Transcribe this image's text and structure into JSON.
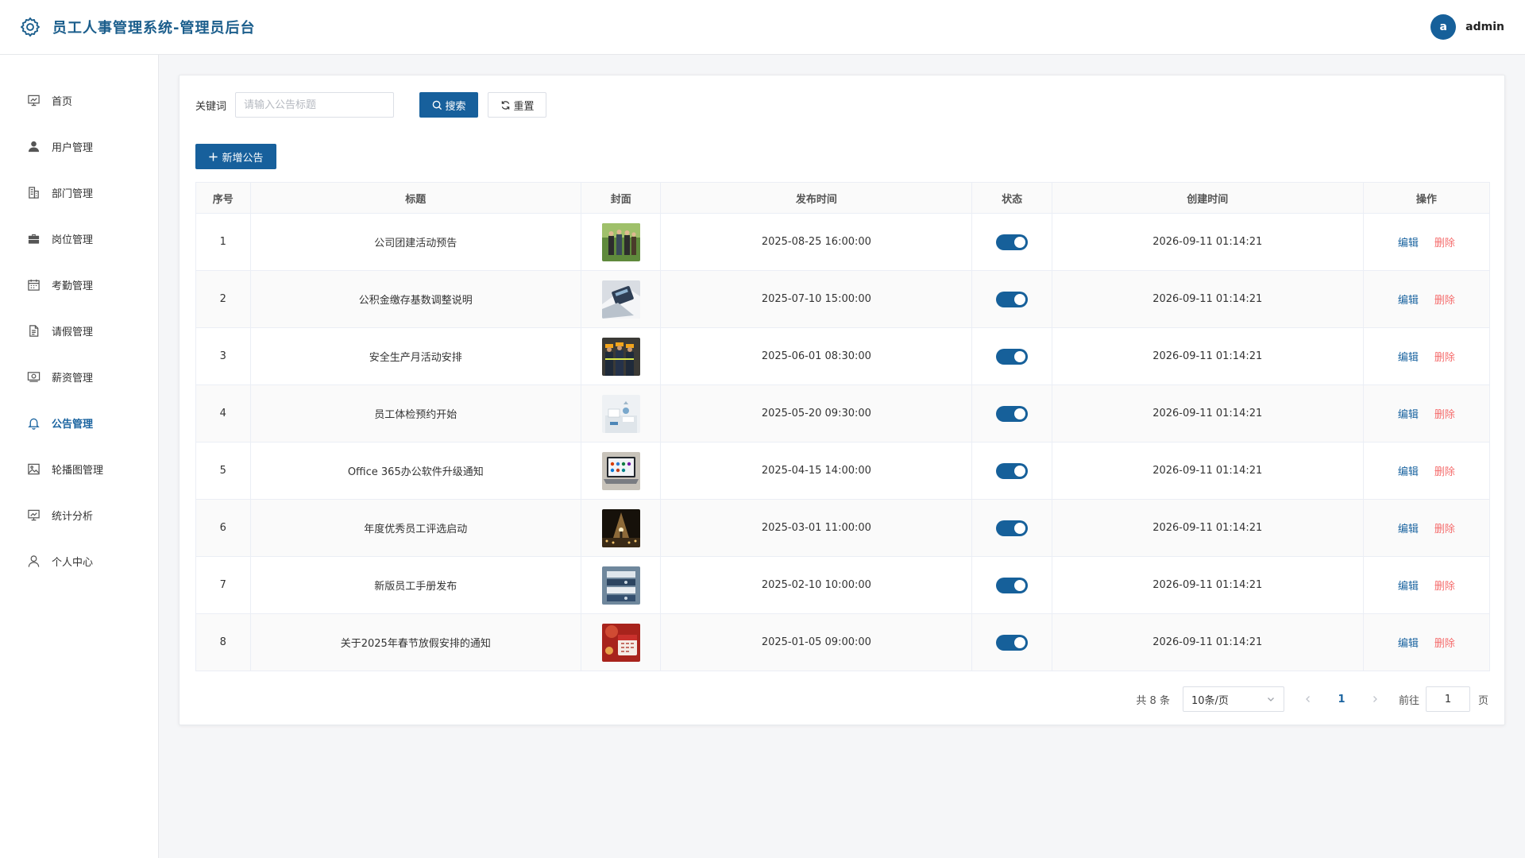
{
  "header": {
    "title": "员工人事管理系统-管理员后台",
    "avatar_letter": "a",
    "username": "admin"
  },
  "sidebar": {
    "items": [
      {
        "label": "首页",
        "icon": "dashboard-icon",
        "active": false
      },
      {
        "label": "用户管理",
        "icon": "user-icon",
        "active": false
      },
      {
        "label": "部门管理",
        "icon": "building-icon",
        "active": false
      },
      {
        "label": "岗位管理",
        "icon": "briefcase-icon",
        "active": false
      },
      {
        "label": "考勤管理",
        "icon": "calendar-icon",
        "active": false
      },
      {
        "label": "请假管理",
        "icon": "document-icon",
        "active": false
      },
      {
        "label": "薪资管理",
        "icon": "money-icon",
        "active": false
      },
      {
        "label": "公告管理",
        "icon": "bell-icon",
        "active": true
      },
      {
        "label": "轮播图管理",
        "icon": "picture-icon",
        "active": false
      },
      {
        "label": "统计分析",
        "icon": "presentation-icon",
        "active": false
      },
      {
        "label": "个人中心",
        "icon": "person-icon",
        "active": false
      }
    ]
  },
  "search": {
    "label": "关键词",
    "placeholder": "请输入公告标题",
    "value": "",
    "search_label": "搜索",
    "reset_label": "重置"
  },
  "toolbar": {
    "add_label": "新增公告"
  },
  "table": {
    "columns": [
      "序号",
      "标题",
      "封面",
      "发布时间",
      "状态",
      "创建时间",
      "操作"
    ],
    "edit_label": "编辑",
    "delete_label": "删除",
    "rows": [
      {
        "index": "1",
        "title": "公司团建活动预告",
        "publish_time": "2025-08-25 16:00:00",
        "status": true,
        "created_time": "2026-09-11 01:14:21",
        "cover": "team-photo"
      },
      {
        "index": "2",
        "title": "公积金缴存基数调整说明",
        "publish_time": "2025-07-10 15:00:00",
        "status": true,
        "created_time": "2026-09-11 01:14:21",
        "cover": "calculator-photo"
      },
      {
        "index": "3",
        "title": "安全生产月活动安排",
        "publish_time": "2025-06-01 08:30:00",
        "status": true,
        "created_time": "2026-09-11 01:14:21",
        "cover": "workers-photo"
      },
      {
        "index": "4",
        "title": "员工体检预约开始",
        "publish_time": "2025-05-20 09:30:00",
        "status": true,
        "created_time": "2026-09-11 01:14:21",
        "cover": "medical-photo"
      },
      {
        "index": "5",
        "title": "Office 365办公软件升级通知",
        "publish_time": "2025-04-15 14:00:00",
        "status": true,
        "created_time": "2026-09-11 01:14:21",
        "cover": "laptop-photo"
      },
      {
        "index": "6",
        "title": "年度优秀员工评选启动",
        "publish_time": "2025-03-01 11:00:00",
        "status": true,
        "created_time": "2026-09-11 01:14:21",
        "cover": "stage-photo"
      },
      {
        "index": "7",
        "title": "新版员工手册发布",
        "publish_time": "2025-02-10 10:00:00",
        "status": true,
        "created_time": "2026-09-11 01:14:21",
        "cover": "books-photo"
      },
      {
        "index": "8",
        "title": "关于2025年春节放假安排的通知",
        "publish_time": "2025-01-05 09:00:00",
        "status": true,
        "created_time": "2026-09-11 01:14:21",
        "cover": "calendar-photo"
      }
    ]
  },
  "pagination": {
    "total_text": "共 8 条",
    "page_size": "10条/页",
    "current_page": "1",
    "goto_label": "前往",
    "goto_value": "1",
    "page_unit": "页"
  },
  "colors": {
    "primary": "#17609c",
    "danger": "#f56c6c",
    "brand_text": "#1b5e8c"
  }
}
